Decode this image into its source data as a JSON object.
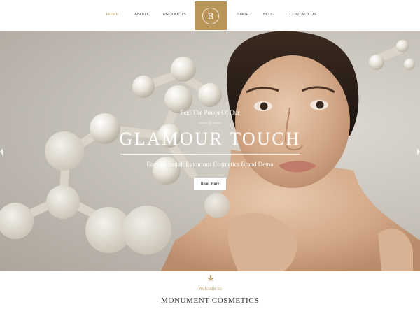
{
  "nav": {
    "items": [
      "HOME",
      "ABOUT",
      "PRODUCTS",
      "SHOP",
      "BLOG",
      "CONTACT US"
    ],
    "active": "HOME",
    "logo_letter": "B"
  },
  "hero": {
    "tagline": "Feel The Power Of Our",
    "title": "GLAMOUR TOUCH",
    "subtitle": "Easy To Install Luxurious Cosmetics Brand Demo",
    "button": "Read More"
  },
  "welcome": {
    "small": "Welcome to",
    "title": "MONUMENT COSMETICS"
  },
  "colors": {
    "accent": "#b9955a",
    "active_link": "#b89a5f",
    "hero_bg": "#c8c3bb"
  },
  "icons": {
    "prev": "chevron-left-icon",
    "next": "chevron-right-icon",
    "welcome": "lotus-icon",
    "divider": "ornament-divider"
  }
}
